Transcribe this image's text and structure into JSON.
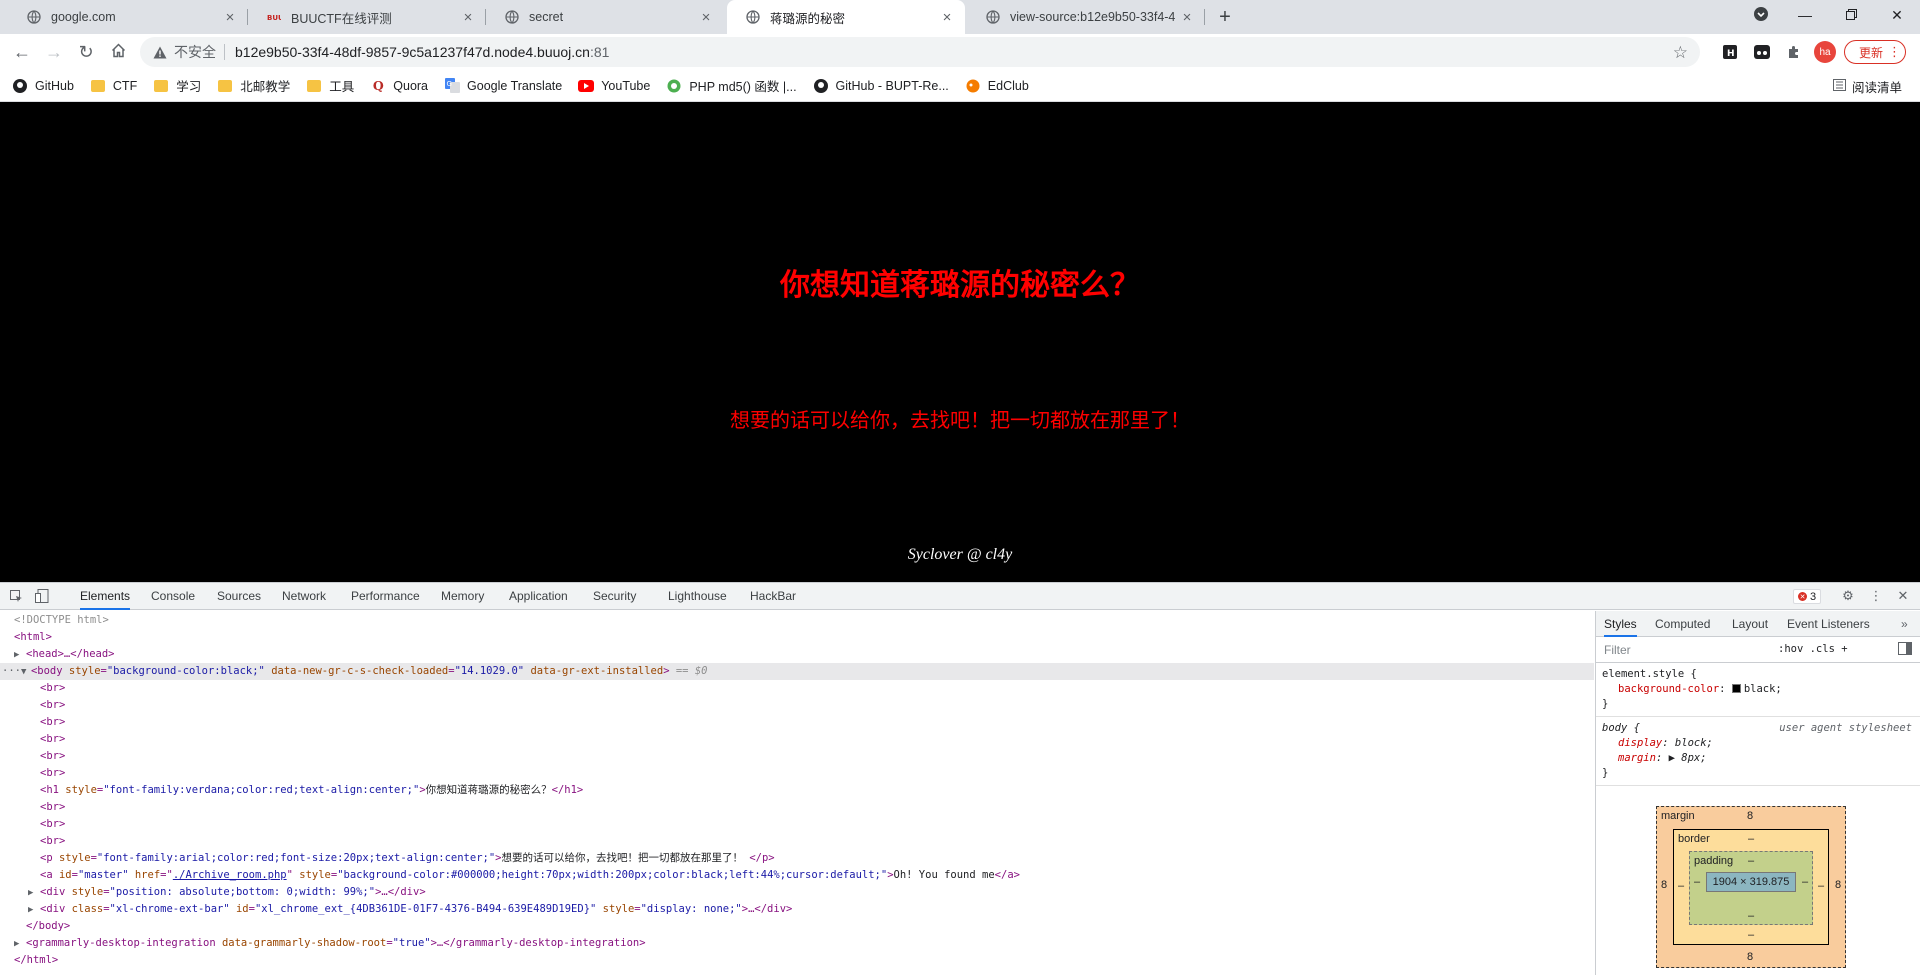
{
  "tabs": [
    {
      "title": "google.com",
      "icon": "globe-icon",
      "active": false
    },
    {
      "title": "BUUCTF在线评测",
      "icon": "buu-icon",
      "active": false
    },
    {
      "title": "secret",
      "icon": "globe-icon",
      "active": false
    },
    {
      "title": "蒋璐源的秘密",
      "icon": "globe-icon",
      "active": true
    },
    {
      "title": "view-source:b12e9b50-33f4-4",
      "icon": "globe-icon",
      "active": false
    }
  ],
  "address": {
    "security_label": "不安全",
    "host": "b12e9b50-33f4-48df-9857-9c5a1237f47d.node4.buuoj.cn",
    "port": ":81"
  },
  "toolbar": {
    "avatar_text": "ha",
    "update_label": "更新"
  },
  "bookmarks": [
    {
      "label": "GitHub",
      "icon": "github-icon"
    },
    {
      "label": "CTF",
      "icon": "folder-icon"
    },
    {
      "label": "学习",
      "icon": "folder-icon"
    },
    {
      "label": "北邮教学",
      "icon": "folder-icon"
    },
    {
      "label": "工具",
      "icon": "folder-icon"
    },
    {
      "label": "Quora",
      "icon": "quora-icon"
    },
    {
      "label": "Google Translate",
      "icon": "translate-icon"
    },
    {
      "label": "YouTube",
      "icon": "youtube-icon"
    },
    {
      "label": "PHP md5() 函数 |...",
      "icon": "php-icon"
    },
    {
      "label": "GitHub - BUPT-Re...",
      "icon": "github-icon"
    },
    {
      "label": "EdClub",
      "icon": "edclub-icon"
    }
  ],
  "reading_list": "阅读清单",
  "page": {
    "heading": "你想知道蒋璐源的秘密么？",
    "paragraph": "想要的话可以给你，去找吧！把一切都放在那里了！",
    "signature": "Syclover @ cl4y",
    "background": "#000000",
    "text_color": "#ff0000"
  },
  "devtools": {
    "tabs": [
      "Elements",
      "Console",
      "Sources",
      "Network",
      "Performance",
      "Memory",
      "Application",
      "Security",
      "Lighthouse",
      "HackBar"
    ],
    "active_tab": "Elements",
    "error_count": "3",
    "dom": {
      "doctype": "<!DOCTYPE html>",
      "html_open": "<html>",
      "head": "<head>…</head>",
      "body_open_tag": "<body ",
      "body_style_attr": "style",
      "body_style_val": "\"background-color:black;\"",
      "body_attr2": "data-new-gr-c-s-check-loaded",
      "body_attr2_val": "\"14.1029.0\"",
      "body_attr3": "data-gr-ext-installed",
      "body_close_bracket": ">",
      "body_eq": " == $0",
      "br": "<br>",
      "h1_open": "<h1 ",
      "h1_style_attr": "style",
      "h1_style_val": "\"font-family:verdana;color:red;text-align:center;\"",
      "h1_text": "你想知道蒋璐源的秘密么？",
      "h1_close": "</h1>",
      "p_open": "<p ",
      "p_style_attr": "style",
      "p_style_val": "\"font-family:arial;color:red;font-size:20px;text-align:center;\"",
      "p_text": "想要的话可以给你，去找吧！把一切都放在那里了！",
      "p_close": "</p>",
      "a_open": "<a ",
      "a_id_attr": "id",
      "a_id_val": "\"master\"",
      "a_href_attr": "href",
      "a_href_val": "./Archive_room.php",
      "a_style_attr": "style",
      "a_style_val": "\"background-color:#000000;height:70px;width:200px;color:black;left:44%;cursor:default;\"",
      "a_text": "Oh! You found me",
      "a_close": "</a>",
      "div1_open": "<div ",
      "div1_style_attr": "style",
      "div1_style_val": "\"position: absolute;bottom: 0;width: 99%;\"",
      "div1_rest": ">…</div>",
      "div2_open": "<div ",
      "div2_class_attr": "class",
      "div2_class_val": "\"xl-chrome-ext-bar\"",
      "div2_id_attr": "id",
      "div2_id_val": "\"xl_chrome_ext_{4DB361DE-01F7-4376-B494-639E489D19ED}\"",
      "div2_style_attr": "style",
      "div2_style_val": "\"display: none;\"",
      "div2_rest": ">…</div>",
      "body_close": "</body>",
      "gram_open": "<grammarly-desktop-integration ",
      "gram_attr": "data-grammarly-shadow-root",
      "gram_val": "\"true\"",
      "gram_rest": ">…</grammarly-desktop-integration>",
      "html_close": "</html>"
    },
    "styles": {
      "tabs": [
        "Styles",
        "Computed",
        "Layout",
        "Event Listeners"
      ],
      "filter_placeholder": "Filter",
      "filter_opts": ":hov  .cls  +",
      "rule1_selector": "element.style {",
      "rule1_prop": "background-color",
      "rule1_val": "black;",
      "rule2_selector": "body {",
      "rule2_source": "user agent stylesheet",
      "rule2_prop1": "display",
      "rule2_val1": "block;",
      "rule2_prop2": "margin",
      "rule2_val2": "8px;",
      "close_brace": "}"
    },
    "box_model": {
      "margin_label": "margin",
      "margin_top": "8",
      "margin_bottom": "8",
      "margin_left": "8",
      "margin_right": "8",
      "border_label": "border",
      "border_value": "–",
      "padding_label": "padding",
      "padding_value": "–",
      "content_size": "1904 × 319.875"
    }
  }
}
